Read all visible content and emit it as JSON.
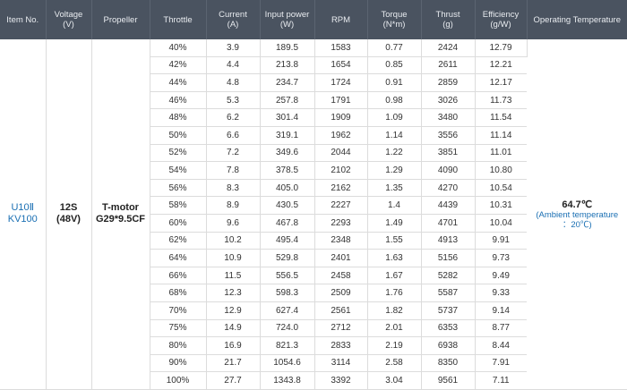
{
  "headers": [
    {
      "main": "Item No.",
      "sub": ""
    },
    {
      "main": "Voltage",
      "sub": "(V)"
    },
    {
      "main": "Propeller",
      "sub": ""
    },
    {
      "main": "Throttle",
      "sub": ""
    },
    {
      "main": "Current",
      "sub": "(A)"
    },
    {
      "main": "Input power",
      "sub": "(W)"
    },
    {
      "main": "RPM",
      "sub": ""
    },
    {
      "main": "Torque",
      "sub": "(N*m)"
    },
    {
      "main": "Thrust",
      "sub": "(g)"
    },
    {
      "main": "Efficiency",
      "sub": "(g/W)"
    },
    {
      "main": "Operating Temperature",
      "sub": ""
    }
  ],
  "item": {
    "line1": "U10Ⅱ",
    "line2": "KV100"
  },
  "voltage": {
    "line1": "12S",
    "line2": "(48V)"
  },
  "propeller": {
    "line1": "T-motor",
    "line2": "G29*9.5CF"
  },
  "temperature": {
    "main": "64.7℃",
    "sub1": "(Ambient temperature",
    "sub2": "：20℃)"
  },
  "rows": [
    [
      "40%",
      "3.9",
      "189.5",
      "1583",
      "0.77",
      "2424",
      "12.79"
    ],
    [
      "42%",
      "4.4",
      "213.8",
      "1654",
      "0.85",
      "2611",
      "12.21"
    ],
    [
      "44%",
      "4.8",
      "234.7",
      "1724",
      "0.91",
      "2859",
      "12.17"
    ],
    [
      "46%",
      "5.3",
      "257.8",
      "1791",
      "0.98",
      "3026",
      "11.73"
    ],
    [
      "48%",
      "6.2",
      "301.4",
      "1909",
      "1.09",
      "3480",
      "11.54"
    ],
    [
      "50%",
      "6.6",
      "319.1",
      "1962",
      "1.14",
      "3556",
      "11.14"
    ],
    [
      "52%",
      "7.2",
      "349.6",
      "2044",
      "1.22",
      "3851",
      "11.01"
    ],
    [
      "54%",
      "7.8",
      "378.5",
      "2102",
      "1.29",
      "4090",
      "10.80"
    ],
    [
      "56%",
      "8.3",
      "405.0",
      "2162",
      "1.35",
      "4270",
      "10.54"
    ],
    [
      "58%",
      "8.9",
      "430.5",
      "2227",
      "1.4",
      "4439",
      "10.31"
    ],
    [
      "60%",
      "9.6",
      "467.8",
      "2293",
      "1.49",
      "4701",
      "10.04"
    ],
    [
      "62%",
      "10.2",
      "495.4",
      "2348",
      "1.55",
      "4913",
      "9.91"
    ],
    [
      "64%",
      "10.9",
      "529.8",
      "2401",
      "1.63",
      "5156",
      "9.73"
    ],
    [
      "66%",
      "11.5",
      "556.5",
      "2458",
      "1.67",
      "5282",
      "9.49"
    ],
    [
      "68%",
      "12.3",
      "598.3",
      "2509",
      "1.76",
      "5587",
      "9.33"
    ],
    [
      "70%",
      "12.9",
      "627.4",
      "2561",
      "1.82",
      "5737",
      "9.14"
    ],
    [
      "75%",
      "14.9",
      "724.0",
      "2712",
      "2.01",
      "6353",
      "8.77"
    ],
    [
      "80%",
      "16.9",
      "821.3",
      "2833",
      "2.19",
      "6938",
      "8.44"
    ],
    [
      "90%",
      "21.7",
      "1054.6",
      "3114",
      "2.58",
      "8350",
      "7.91"
    ],
    [
      "100%",
      "27.7",
      "1343.8",
      "3392",
      "3.04",
      "9561",
      "7.11"
    ]
  ]
}
